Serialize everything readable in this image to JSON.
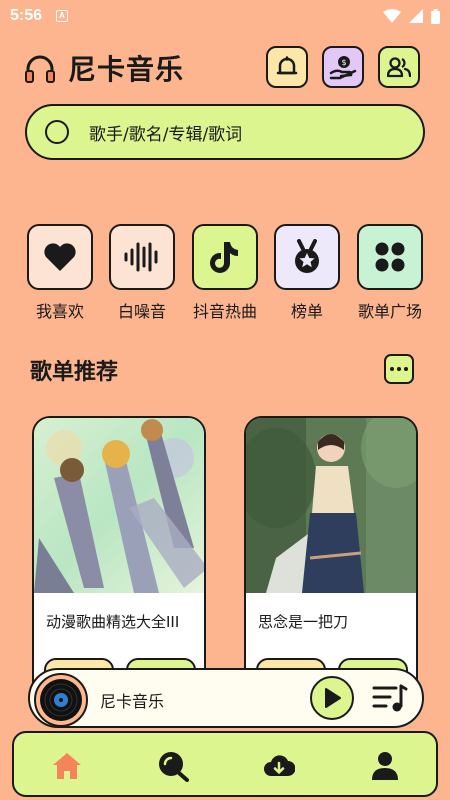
{
  "status_bar": {
    "time": "5:56",
    "notification_icon": "A"
  },
  "header": {
    "app_title": "尼卡音乐",
    "icons": [
      "headphones-icon",
      "bell-icon",
      "money-bag-icon",
      "users-icon"
    ]
  },
  "search": {
    "placeholder": "歌手/歌名/专辑/歌词"
  },
  "categories": [
    {
      "label": "我喜欢",
      "icon": "heart-icon",
      "color": "#fde3d3"
    },
    {
      "label": "白噪音",
      "icon": "waveform-icon",
      "color": "#fde3d3"
    },
    {
      "label": "抖音热曲",
      "icon": "tiktok-icon",
      "color": "#dcf58f"
    },
    {
      "label": "榜单",
      "icon": "medal-icon",
      "color": "#eee8fb"
    },
    {
      "label": "歌单广场",
      "icon": "grid-icon",
      "color": "#c8f2d4"
    }
  ],
  "section": {
    "title": "歌单推荐"
  },
  "playlists": [
    {
      "title": "动漫歌曲精选大全III"
    },
    {
      "title": "思念是一把刀"
    }
  ],
  "player": {
    "title": "尼卡音乐"
  },
  "tabs": [
    "home-icon",
    "search-icon",
    "download-icon",
    "user-icon"
  ],
  "colors": {
    "background": "#fcb58f",
    "accent": "#dcf58f",
    "home_active": "#f5845a"
  }
}
